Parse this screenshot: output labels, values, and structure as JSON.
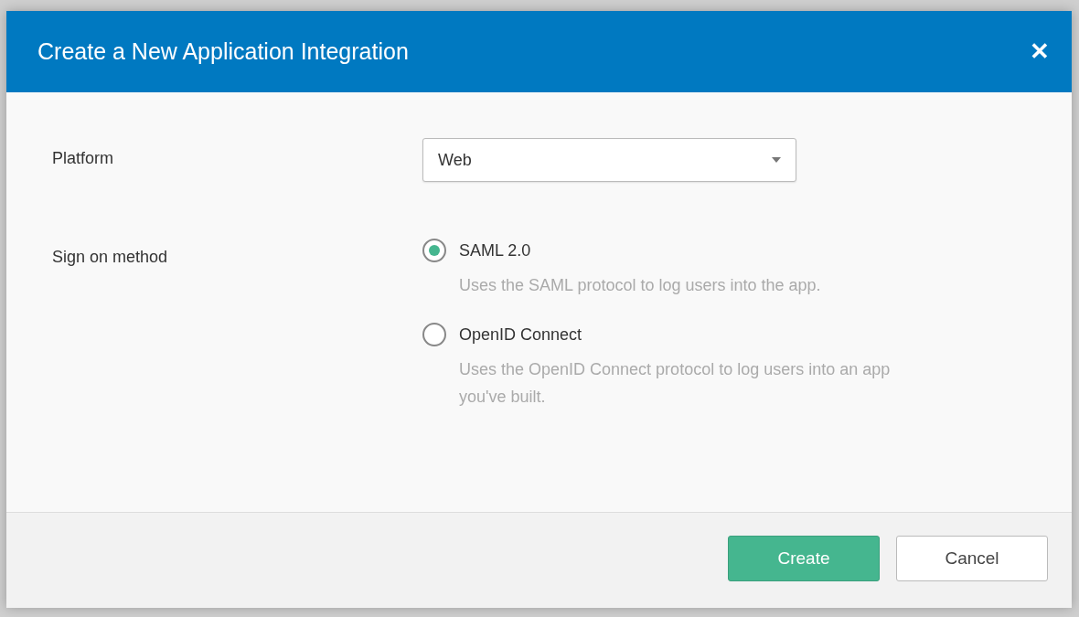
{
  "dialog": {
    "title": "Create a New Application Integration",
    "close": "✕"
  },
  "platform": {
    "label": "Platform",
    "value": "Web"
  },
  "sign_on_method": {
    "label": "Sign on method",
    "options": [
      {
        "label": "SAML 2.0",
        "description": "Uses the SAML protocol to log users into the app.",
        "selected": true
      },
      {
        "label": "OpenID Connect",
        "description": "Uses the OpenID Connect protocol to log users into an app you've built.",
        "selected": false
      }
    ]
  },
  "buttons": [
    {
      "label": "Create",
      "kind": "primary"
    },
    {
      "label": "Cancel",
      "kind": "secondary"
    }
  ]
}
